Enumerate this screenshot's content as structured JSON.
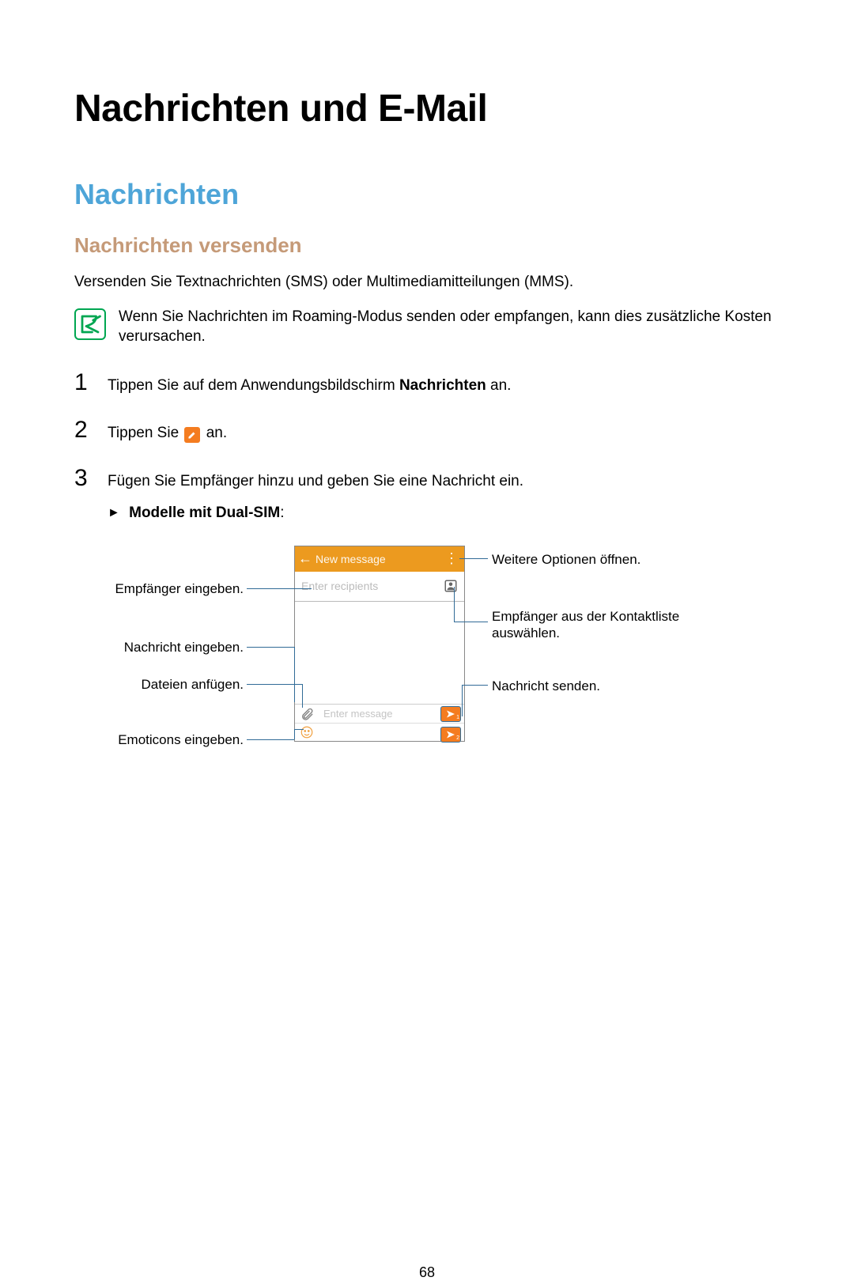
{
  "page_number": "68",
  "h1": "Nachrichten und E-Mail",
  "h2": "Nachrichten",
  "h3": "Nachrichten versenden",
  "intro": "Versenden Sie Textnachrichten (SMS) oder Multimediamitteilungen (MMS).",
  "note": "Wenn Sie Nachrichten im Roaming-Modus senden oder empfangen, kann dies zusätzliche Kosten verursachen.",
  "steps": {
    "n1": "1",
    "n2": "2",
    "n3": "3",
    "s1_a": "Tippen Sie auf dem Anwendungsbildschirm ",
    "s1_b": "Nachrichten",
    "s1_c": " an.",
    "s2_a": "Tippen Sie ",
    "s2_b": " an.",
    "s3": "Fügen Sie Empfänger hinzu und geben Sie eine Nachricht ein.",
    "s3_sub": "Modelle mit Dual-SIM",
    "s3_sub_colon": ":"
  },
  "phone": {
    "title": "New message",
    "recipients_placeholder": "Enter recipients",
    "message_placeholder": "Enter message"
  },
  "callouts": {
    "recipients": "Empfänger eingeben.",
    "message": "Nachricht eingeben.",
    "attach": "Dateien anfügen.",
    "emoticons": "Emoticons eingeben.",
    "more": "Weitere Optionen öffnen.",
    "contacts": "Empfänger aus der Kontaktliste auswählen.",
    "send": "Nachricht senden."
  }
}
